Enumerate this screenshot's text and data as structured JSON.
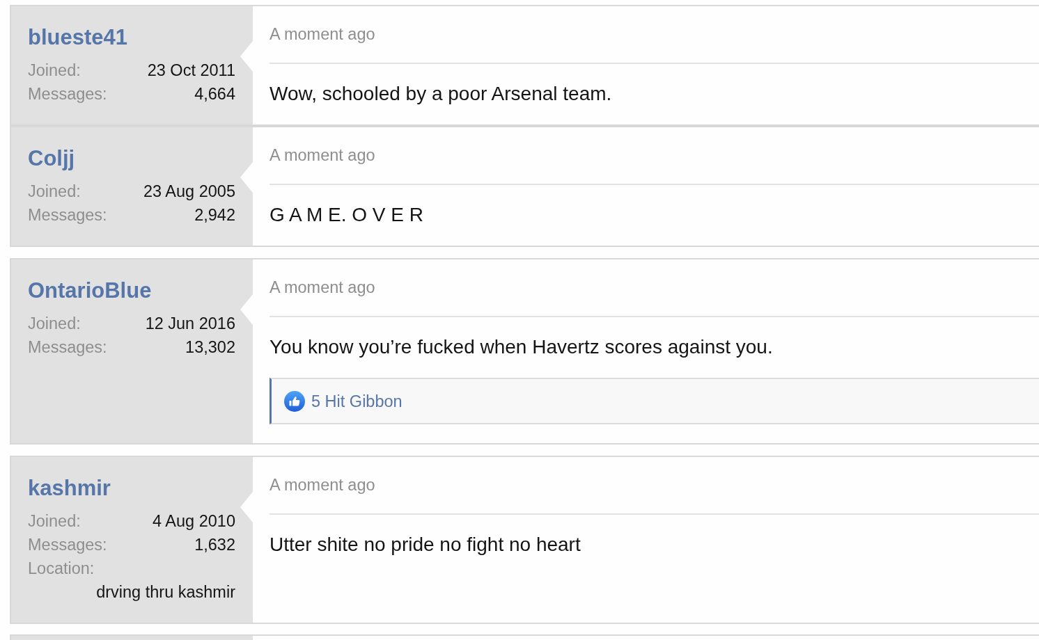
{
  "posts": [
    {
      "user": {
        "name": "blueste41",
        "fields": [
          {
            "kind": "pair",
            "label": "Joined:",
            "value": "23 Oct 2011"
          },
          {
            "kind": "pair",
            "label": "Messages:",
            "value": "4,664"
          }
        ]
      },
      "time": "A moment ago",
      "message": "Wow, schooled by a poor Arsenal team."
    },
    {
      "user": {
        "name": "Coljj",
        "fields": [
          {
            "kind": "pair",
            "label": "Joined:",
            "value": "23 Aug 2005"
          },
          {
            "kind": "pair",
            "label": "Messages:",
            "value": "2,942"
          }
        ]
      },
      "time": "A moment ago",
      "message": "G A M E. O V E R"
    },
    {
      "user": {
        "name": "OntarioBlue",
        "fields": [
          {
            "kind": "pair",
            "label": "Joined:",
            "value": "12 Jun 2016"
          },
          {
            "kind": "pair",
            "label": "Messages:",
            "value": "13,302"
          }
        ]
      },
      "time": "A moment ago",
      "message": "You know you’re fucked when Havertz scores against you.",
      "reactions": {
        "text": "5 Hit Gibbon"
      }
    },
    {
      "user": {
        "name": "kashmir",
        "fields": [
          {
            "kind": "pair",
            "label": "Joined:",
            "value": "4 Aug 2010"
          },
          {
            "kind": "pair",
            "label": "Messages:",
            "value": "1,632"
          },
          {
            "kind": "stacked",
            "label": "Location:",
            "value": "drving thru kashmir"
          }
        ]
      },
      "time": "A moment ago",
      "message": "Utter shite no pride no fight no heart"
    }
  ]
}
